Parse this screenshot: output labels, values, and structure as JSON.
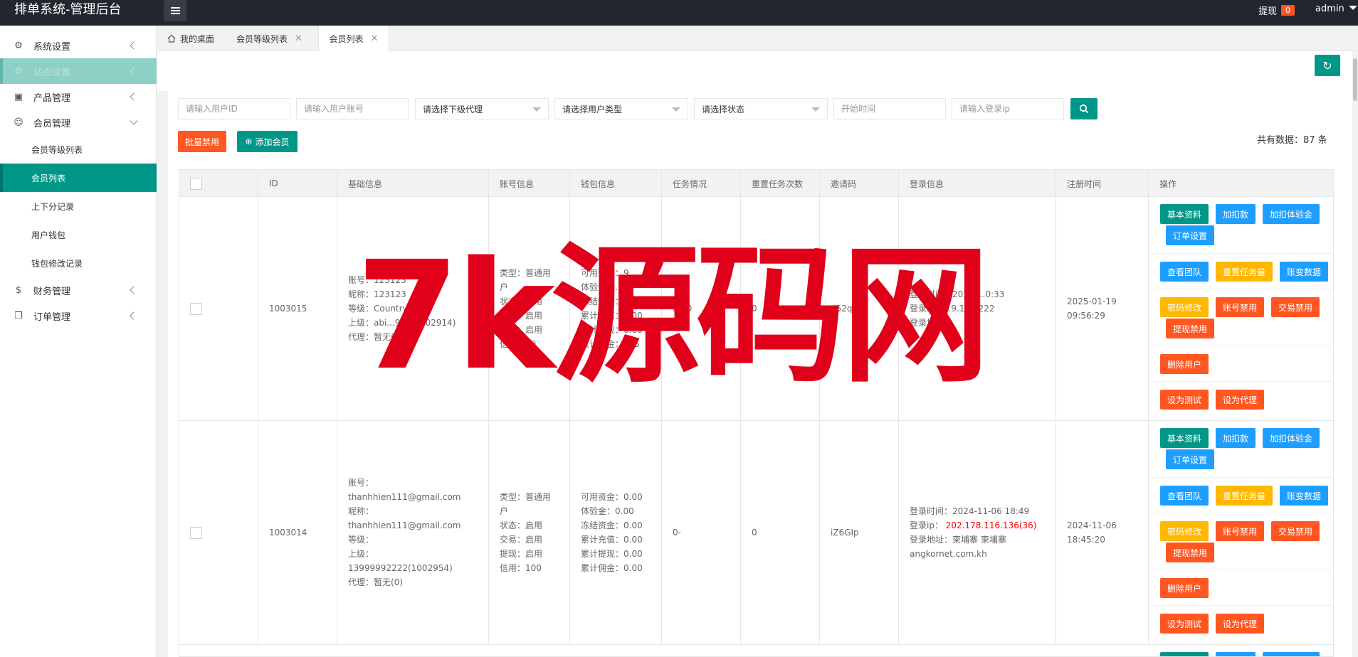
{
  "app": {
    "title": "排单系统-管理后台"
  },
  "header": {
    "withdraw_label": "提现",
    "withdraw_count": "0",
    "user": "admin"
  },
  "sidebar": {
    "items": [
      {
        "label": "系统设置",
        "icon": "gear-icon"
      },
      {
        "label": "站点设置",
        "icon": "settings-icon"
      },
      {
        "label": "产品管理",
        "icon": "box-icon"
      },
      {
        "label": "会员管理",
        "icon": "user-icon"
      },
      {
        "label": "财务管理",
        "icon": "dollar-icon"
      },
      {
        "label": "订单管理",
        "icon": "cube-icon"
      }
    ],
    "sub_items": [
      {
        "label": "会员等级列表"
      },
      {
        "label": "会员列表"
      },
      {
        "label": "上下分记录"
      },
      {
        "label": "用户钱包"
      },
      {
        "label": "钱包修改记录"
      }
    ]
  },
  "tabs": [
    {
      "label": "我的桌面"
    },
    {
      "label": "会员等级列表"
    },
    {
      "label": "会员列表"
    }
  ],
  "filters": {
    "user_id_placeholder": "请输入用户ID",
    "account_placeholder": "请输入用户账号",
    "agent_select": "请选择下级代理",
    "type_select": "请选择用户类型",
    "status_select": "请选择状态",
    "start_time_placeholder": "开始时间",
    "ip_placeholder": "请输入登录ip"
  },
  "toolbar": {
    "batch_disable": "批量禁用",
    "add_member": "添加会员",
    "total_label": "共有数据：87 条"
  },
  "table": {
    "headers": [
      "ID",
      "基础信息",
      "账号信息",
      "钱包信息",
      "任务情况",
      "重置任务次数",
      "邀请码",
      "登录信息",
      "注册时间",
      "操作"
    ],
    "rows": [
      {
        "id": "1003015",
        "basic": [
          "账号：123123",
          "昵称：123123",
          "等级：Country",
          "上级：abi...999(1002914)",
          "代理：暂无(0)"
        ],
        "account": [
          "类型：普通用户",
          "状态：启用",
          "交易：启用",
          "提现：启用",
          "信用：99"
        ],
        "wallet": [
          "可用资金：9...",
          "体验金：...",
          "冻结资金：0.00",
          "累计充值：0.00",
          "累计提现：0.00",
          "累计佣金：105"
        ],
        "task": "0-50",
        "reset": "0",
        "invite": "d52qqY",
        "login": [
          "登录时间：2025-...0:33",
          "登录ip：...9.11...222",
          "登录地址："
        ],
        "login_ip": "",
        "register": "2025-01-19 09:56:29"
      },
      {
        "id": "1003014",
        "basic": [
          "账号：thanhhien111@gmail.com",
          "昵称：thanhhien111@gmail.com",
          "等级：",
          "上级：13999992222(1002954)",
          "代理：暂无(0)"
        ],
        "account": [
          "类型：普通用户",
          "状态：启用",
          "交易：启用",
          "提现：启用",
          "信用：100"
        ],
        "wallet": [
          "可用资金：0.00",
          "体验金：0.00",
          "冻结资金：0.00",
          "累计充值：0.00",
          "累计提现：0.00",
          "累计佣金：0.00"
        ],
        "task": "0-",
        "reset": "0",
        "invite": "iZ6GIp",
        "login_time": "登录时间：2024-11-06 18:49",
        "login_ip_label": "登录ip：",
        "login_ip": "202.178.116.136(36)",
        "login_addr": "登录地址：柬埔寨 柬埔寨 angkornet.com.kh",
        "register": "2024-11-06 18:45:20"
      }
    ],
    "ops": {
      "basic_info": "基本资料",
      "add_deduct": "加扣款",
      "add_deduct_trial": "加扣体验金",
      "order_settings": "订单设置",
      "view_team": "查看团队",
      "reset_tasks": "重置任务量",
      "account_changes": "账变数据",
      "password_change": "密码修改",
      "disable_account": "账号禁用",
      "disable_trade": "交易禁用",
      "disable_withdraw": "提现禁用",
      "delete_user": "删除用户",
      "set_test": "设为测试",
      "set_agent": "设为代理"
    }
  },
  "watermark": "7k源码网",
  "colors": {
    "primary": "#009688",
    "orange": "#ff5722",
    "blue": "#1e9fff",
    "yellow": "#ffb800",
    "header": "#23262e"
  }
}
